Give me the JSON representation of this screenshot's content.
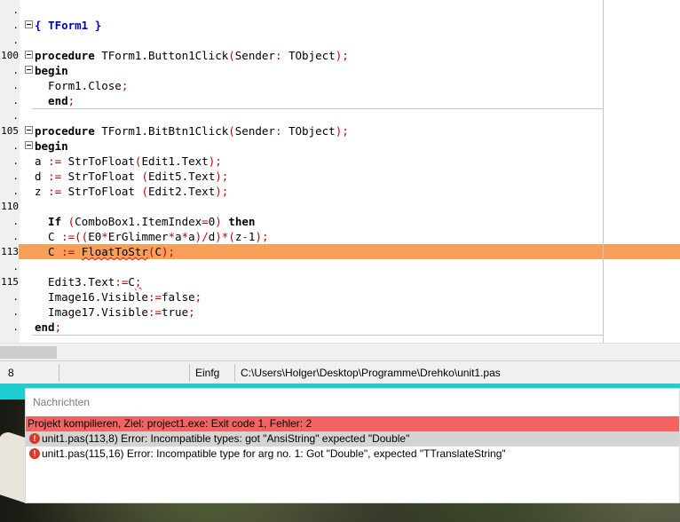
{
  "editor": {
    "lines": [
      {
        "num": ".",
        "tokens": []
      },
      {
        "num": ".",
        "fold": true,
        "tokens": [
          {
            "t": "{ TForm1 }",
            "c": "com"
          }
        ]
      },
      {
        "num": ".",
        "tokens": []
      },
      {
        "num": "100",
        "fold": true,
        "tokens": [
          {
            "t": "procedure",
            "c": "kw"
          },
          {
            "t": " TForm1.Button1Click"
          },
          {
            "t": "(",
            "c": "sym"
          },
          {
            "t": "Sender"
          },
          {
            "t": ":",
            "c": "sym"
          },
          {
            "t": " TObject"
          },
          {
            "t": ");",
            "c": "sym"
          }
        ]
      },
      {
        "num": ".",
        "fold": true,
        "tokens": [
          {
            "t": "begin",
            "c": "kw"
          }
        ]
      },
      {
        "num": ".",
        "tokens": [
          {
            "t": "  Form1.Close"
          },
          {
            "t": ";",
            "c": "sym"
          }
        ]
      },
      {
        "num": ".",
        "tokens": [
          {
            "t": "  end",
            "c": "kw"
          },
          {
            "t": ";",
            "c": "sym"
          }
        ]
      },
      {
        "num": ".",
        "tokens": []
      },
      {
        "num": "105",
        "fold": true,
        "tokens": [
          {
            "t": "procedure",
            "c": "kw"
          },
          {
            "t": " TForm1.BitBtn1Click"
          },
          {
            "t": "(",
            "c": "sym"
          },
          {
            "t": "Sender"
          },
          {
            "t": ":",
            "c": "sym"
          },
          {
            "t": " TObject"
          },
          {
            "t": ");",
            "c": "sym"
          }
        ]
      },
      {
        "num": ".",
        "fold": true,
        "tokens": [
          {
            "t": "begin",
            "c": "kw"
          }
        ]
      },
      {
        "num": ".",
        "tokens": [
          {
            "t": "a "
          },
          {
            "t": ":=",
            "c": "sym"
          },
          {
            "t": " StrToFloat"
          },
          {
            "t": "(",
            "c": "sym"
          },
          {
            "t": "Edit1.Text"
          },
          {
            "t": ");",
            "c": "sym"
          }
        ]
      },
      {
        "num": ".",
        "tokens": [
          {
            "t": "d "
          },
          {
            "t": ":=",
            "c": "sym"
          },
          {
            "t": " StrToFloat "
          },
          {
            "t": "(",
            "c": "sym"
          },
          {
            "t": "Edit5.Text"
          },
          {
            "t": ");",
            "c": "sym"
          }
        ]
      },
      {
        "num": ".",
        "tokens": [
          {
            "t": "z "
          },
          {
            "t": ":=",
            "c": "sym"
          },
          {
            "t": " StrToFloat "
          },
          {
            "t": "(",
            "c": "sym"
          },
          {
            "t": "Edit2.Text"
          },
          {
            "t": ");",
            "c": "sym"
          }
        ]
      },
      {
        "num": "110",
        "tokens": []
      },
      {
        "num": ".",
        "tokens": [
          {
            "t": "  If ",
            "c": "kw"
          },
          {
            "t": "(",
            "c": "sym"
          },
          {
            "t": "ComboBox1.ItemIndex"
          },
          {
            "t": "=",
            "c": "sym"
          },
          {
            "t": "0"
          },
          {
            "t": ")",
            "c": "sym"
          },
          {
            "t": " then",
            "c": "kw"
          }
        ]
      },
      {
        "num": ".",
        "tokens": [
          {
            "t": "  C "
          },
          {
            "t": ":=((",
            "c": "sym"
          },
          {
            "t": "E0"
          },
          {
            "t": "*",
            "c": "sym"
          },
          {
            "t": "ErGlimmer"
          },
          {
            "t": "*",
            "c": "sym"
          },
          {
            "t": "a"
          },
          {
            "t": "*",
            "c": "sym"
          },
          {
            "t": "a"
          },
          {
            "t": ")/",
            "c": "sym"
          },
          {
            "t": "d"
          },
          {
            "t": ")*(",
            "c": "sym"
          },
          {
            "t": "z"
          },
          {
            "t": "-",
            "c": "sym"
          },
          {
            "t": "1"
          },
          {
            "t": ");",
            "c": "sym"
          }
        ]
      },
      {
        "num": "113",
        "hl": true,
        "tokens": [
          {
            "t": "  C "
          },
          {
            "t": ":=",
            "c": "sym"
          },
          {
            "t": " "
          },
          {
            "t": "FloatToStr",
            "c": "squig"
          },
          {
            "t": "(",
            "c": "sym"
          },
          {
            "t": "C"
          },
          {
            "t": ");",
            "c": "sym"
          }
        ]
      },
      {
        "num": ".",
        "tokens": []
      },
      {
        "num": "115",
        "tokens": [
          {
            "t": "  Edit3.Text"
          },
          {
            "t": ":=",
            "c": "sym"
          },
          {
            "t": "C",
            "c": "plain"
          },
          {
            "t": ";",
            "c": "squigsym"
          }
        ]
      },
      {
        "num": ".",
        "tokens": [
          {
            "t": "  Image16.Visible"
          },
          {
            "t": ":=",
            "c": "sym"
          },
          {
            "t": "false"
          },
          {
            "t": ";",
            "c": "sym"
          }
        ]
      },
      {
        "num": ".",
        "tokens": [
          {
            "t": "  Image17.Visible"
          },
          {
            "t": ":=",
            "c": "sym"
          },
          {
            "t": "true"
          },
          {
            "t": ";",
            "c": "sym"
          }
        ]
      },
      {
        "num": ".",
        "tokens": [
          {
            "t": "end",
            "c": "kw"
          },
          {
            "t": ";",
            "c": "sym"
          }
        ]
      }
    ]
  },
  "statusbar": {
    "position": "8",
    "mode": "Einfg",
    "file_path": "C:\\Users\\Holger\\Desktop\\Programme\\Drehko\\unit1.pas"
  },
  "messages": {
    "title": "Nachrichten",
    "summary": "Projekt kompilieren, Ziel: project1.exe: Exit code 1, Fehler: 2",
    "items": [
      {
        "icon": "error-icon",
        "text": "unit1.pas(113,8) Error: Incompatible types: got \"AnsiString\" expected \"Double\""
      },
      {
        "icon": "error-icon",
        "text": "unit1.pas(115,16) Error: Incompatible type for arg no. 1: Got \"Double\", expected \"TTranslateString\""
      }
    ]
  },
  "colors": {
    "highlight_line": "#f8a05a",
    "error_banner": "#f26464",
    "error_icon": "#d83a2a",
    "comment": "#0000c0",
    "symbol": "#c00000"
  }
}
